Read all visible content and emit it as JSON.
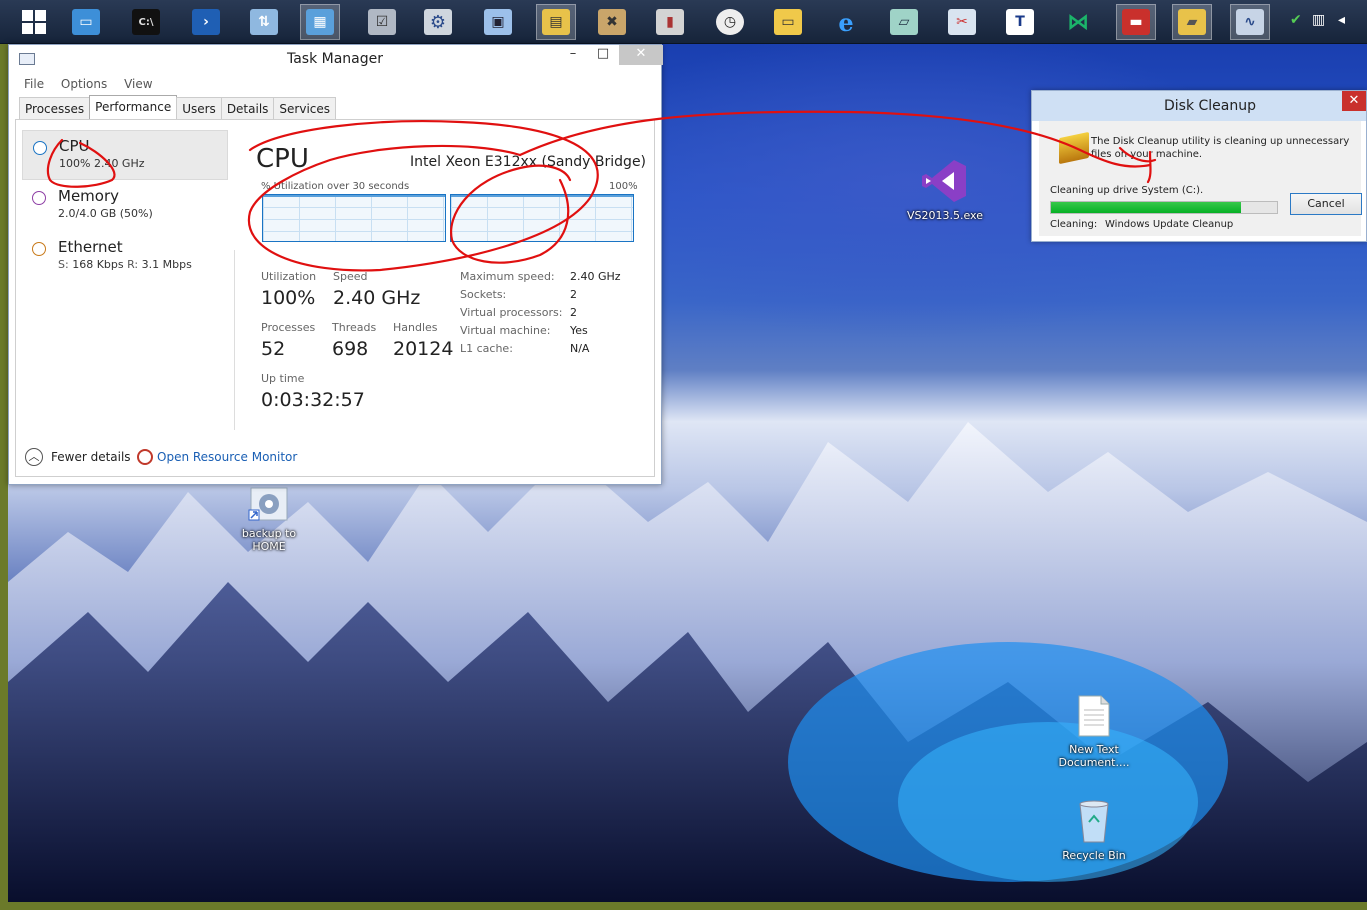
{
  "taskbar": {
    "icons": [
      "windows-logo",
      "server-manager",
      "command-prompt",
      "powershell",
      "network-config",
      "control-panel",
      "task-scheduler",
      "settings",
      "remote-desktop",
      "program-files",
      "tools",
      "registry",
      "clock",
      "file-explorer",
      "internet-explorer",
      "notepad-plus",
      "paint",
      "word-doc",
      "visual-studio",
      "toolbox",
      "disk-cleanup",
      "performance"
    ]
  },
  "task_manager": {
    "title": "Task Manager",
    "menu": [
      "File",
      "Options",
      "View"
    ],
    "tabs": [
      "Processes",
      "Performance",
      "Users",
      "Details",
      "Services"
    ],
    "active_tab": "Performance",
    "sidebar": [
      {
        "name": "CPU",
        "sub": "100%  2.40 GHz",
        "color": "#1a74c4"
      },
      {
        "name": "Memory",
        "sub": "2.0/4.0 GB (50%)",
        "color": "#8e3fa5"
      },
      {
        "name": "Ethernet",
        "sub_s_label": "S:",
        "sub_s": "168 Kbps",
        "sub_r_label": "R:",
        "sub_r": "3.1 Mbps",
        "color": "#c87a1a"
      }
    ],
    "cpu_title": "CPU",
    "cpu_model": "Intel Xeon E312xx (Sandy Bridge)",
    "graph_label": "% Utilization over 30 seconds",
    "graph_max": "100%",
    "graph_fill_fraction": 1.0,
    "stats": {
      "utilization_label": "Utilization",
      "utilization": "100%",
      "speed_label": "Speed",
      "speed": "2.40 GHz",
      "processes_label": "Processes",
      "processes": "52",
      "threads_label": "Threads",
      "threads": "698",
      "handles_label": "Handles",
      "handles": "20124",
      "uptime_label": "Up time",
      "uptime": "0:03:32:57"
    },
    "details": [
      {
        "k": "Maximum speed:",
        "v": "2.40 GHz"
      },
      {
        "k": "Sockets:",
        "v": "2"
      },
      {
        "k": "Virtual processors:",
        "v": "2"
      },
      {
        "k": "Virtual machine:",
        "v": "Yes"
      },
      {
        "k": "L1 cache:",
        "v": "N/A"
      }
    ],
    "fewer_details": "Fewer details",
    "resource_monitor": "Open Resource Monitor"
  },
  "disk_cleanup": {
    "title": "Disk Cleanup",
    "message": "The Disk Cleanup utility is cleaning up unnecessary files on your machine.",
    "drive_line": "Cleaning up drive System (C:).",
    "progress_fraction": 0.84,
    "cancel": "Cancel",
    "cleaning_label": "Cleaning:",
    "cleaning_item": "Windows Update Cleanup"
  },
  "desktop_icons": {
    "vs": "VS2013.5.exe",
    "backup_line1": "backup to",
    "backup_line2": "HOME",
    "newtext_line1": "New Text",
    "newtext_line2": "Document....",
    "recycle": "Recycle Bin"
  }
}
